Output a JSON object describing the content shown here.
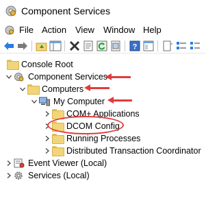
{
  "window": {
    "title": "Component Services",
    "icon": "component-services-icon"
  },
  "menu": {
    "items": [
      "File",
      "Action",
      "View",
      "Window",
      "Help"
    ]
  },
  "toolbar": {
    "buttons": [
      "back-icon",
      "forward-icon",
      "up-folder-icon",
      "show-hide-tree-icon",
      "delete-icon",
      "properties-icon",
      "refresh-icon",
      "export-icon",
      "help-icon",
      "show-console-icon",
      "view-icon",
      "list-icon",
      "details-icon"
    ]
  },
  "tree": {
    "root": "Console Root",
    "component_services": "Component Services",
    "computers": "Computers",
    "my_computer": "My Computer",
    "com_plus": "COM+ Applications",
    "dcom_config": "DCOM Config",
    "running_processes": "Running Processes",
    "dtc": "Distributed Transaction Coordinator",
    "event_viewer": "Event Viewer (Local)",
    "services": "Services (Local)"
  },
  "annotations": {
    "color": "#e23b3b"
  }
}
